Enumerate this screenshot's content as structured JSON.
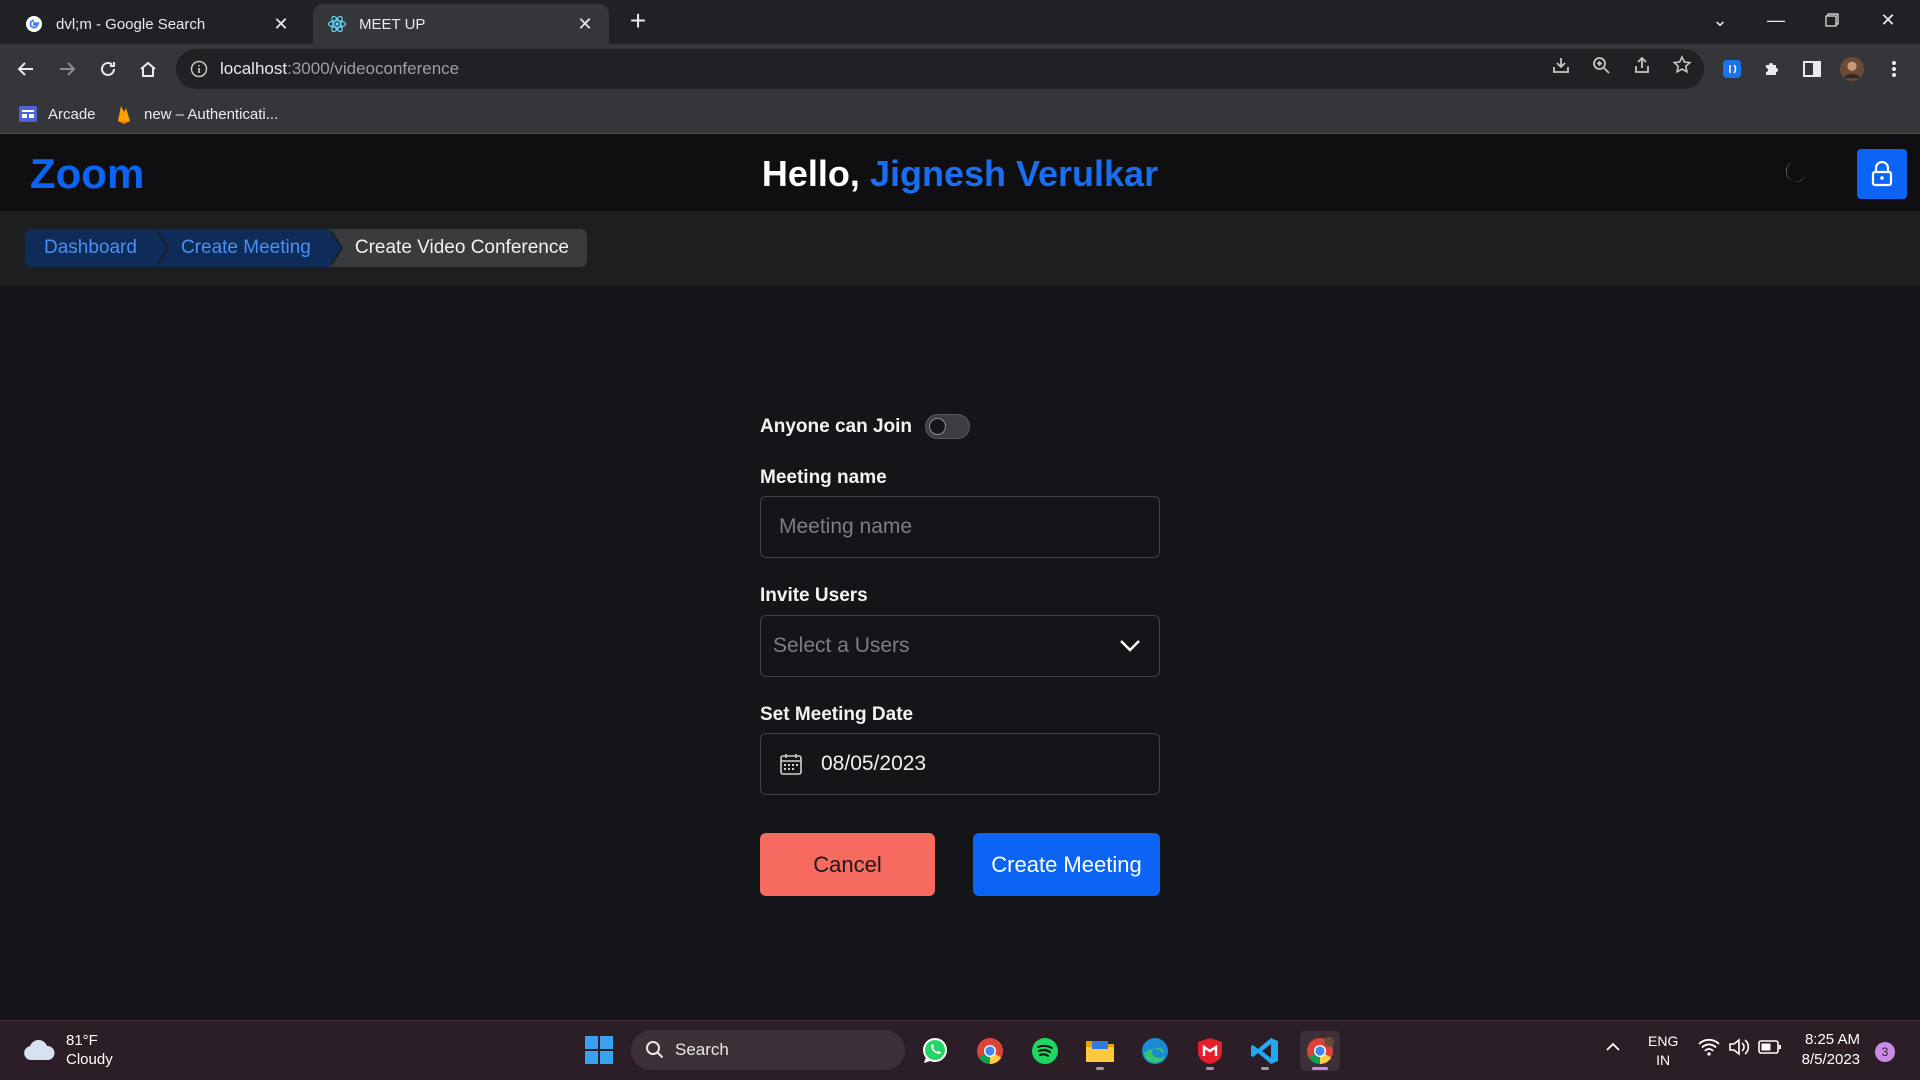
{
  "browser": {
    "tabs": [
      {
        "title": "dvl;m - Google Search",
        "icon": "google-icon",
        "active": false
      },
      {
        "title": "MEET UP",
        "icon": "react-icon",
        "active": true
      }
    ],
    "url_host": "localhost",
    "url_path": ":3000/videoconference",
    "bookmarks": [
      {
        "label": "Arcade",
        "icon": "arcade-icon"
      },
      {
        "label": "new – Authenticati...",
        "icon": "firebase-icon"
      }
    ]
  },
  "app": {
    "logo": "Zoom",
    "greeting_prefix": "Hello, ",
    "user_name": "Jignesh Verulkar",
    "accent": "#0b64f4"
  },
  "breadcrumbs": [
    {
      "label": "Dashboard"
    },
    {
      "label": "Create Meeting"
    },
    {
      "label": "Create Video Conference"
    }
  ],
  "form": {
    "anyone_can_join_label": "Anyone can Join",
    "anyone_can_join": false,
    "meeting_name_label": "Meeting name",
    "meeting_name_placeholder": "Meeting name",
    "invite_users_label": "Invite Users",
    "invite_users_placeholder": "Select a Users",
    "date_label": "Set Meeting Date",
    "date_value": "08/05/2023",
    "cancel_label": "Cancel",
    "create_label": "Create Meeting",
    "cancel_color": "#f76a60"
  },
  "taskbar": {
    "weather_temp": "81°F",
    "weather_desc": "Cloudy",
    "search_label": "Search",
    "lang_line1": "ENG",
    "lang_line2": "IN",
    "time": "8:25 AM",
    "date": "8/5/2023",
    "notification_count": "3"
  }
}
